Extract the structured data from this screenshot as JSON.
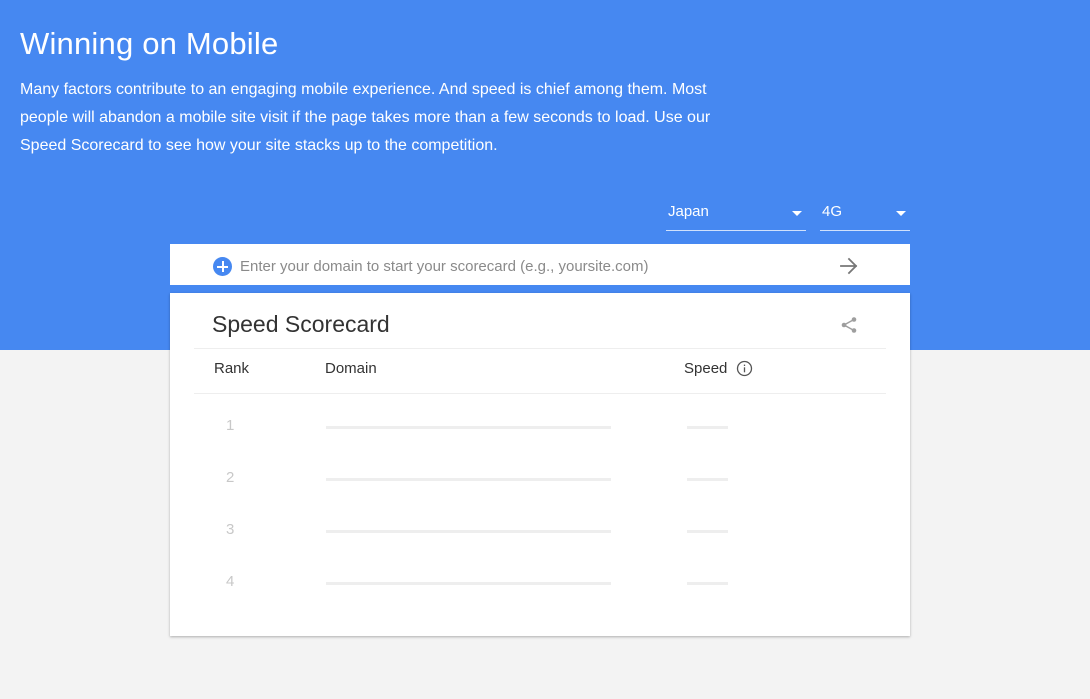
{
  "hero": {
    "title": "Winning on Mobile",
    "description": "Many factors contribute to an engaging mobile experience. And speed is chief among them. Most people will abandon a mobile site visit if the page takes more than a few seconds to load. Use our Speed Scorecard to see how your site stacks up to the competition."
  },
  "filters": {
    "country": "Japan",
    "network": "4G"
  },
  "search": {
    "placeholder": "Enter your domain to start your scorecard (e.g., yoursite.com)",
    "value": ""
  },
  "scorecard": {
    "title": "Speed Scorecard",
    "columns": {
      "rank": "Rank",
      "domain": "Domain",
      "speed": "Speed"
    },
    "rows": [
      {
        "rank": "1"
      },
      {
        "rank": "2"
      },
      {
        "rank": "3"
      },
      {
        "rank": "4"
      }
    ]
  },
  "colors": {
    "brand_blue": "#4688f1",
    "background": "#f3f3f3",
    "placeholder_line": "#eeeeee"
  },
  "icons": [
    "plus-icon",
    "arrow-right-icon",
    "share-icon",
    "info-icon",
    "chevron-down-icon"
  ]
}
